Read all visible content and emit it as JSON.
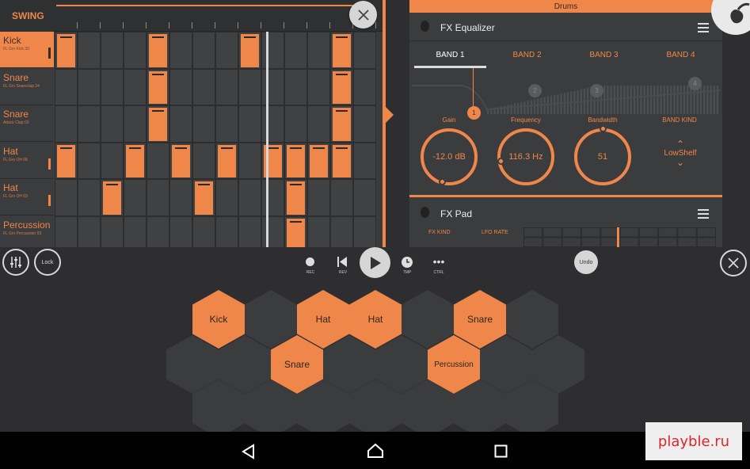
{
  "sequencer": {
    "swing_label": "SWING",
    "tracks": [
      {
        "name": "Kick",
        "sample": "FL Grv Kick 30",
        "selected": true
      },
      {
        "name": "Snare",
        "sample": "FL Grv Snareclap 24",
        "selected": false
      },
      {
        "name": "Snare",
        "sample": "Attack Clap 03",
        "selected": false
      },
      {
        "name": "Hat",
        "sample": "FL Grv OH 08",
        "selected": false
      },
      {
        "name": "Hat",
        "sample": "FL Grv OH 03",
        "selected": false
      },
      {
        "name": "Percussion",
        "sample": "FL Grv Percussion 03",
        "selected": false
      }
    ],
    "steps_on": [
      [
        0,
        4,
        8,
        12
      ],
      [
        4,
        12
      ],
      [
        4,
        12
      ],
      [
        0,
        3,
        5,
        7,
        9,
        10,
        11,
        12
      ],
      [
        2,
        6,
        10
      ],
      [
        10
      ]
    ],
    "playhead_step": 9
  },
  "fx_panel": {
    "channel_title": "Drums",
    "eq_title": "FX Equalizer",
    "bands": [
      "BAND 1",
      "BAND 2",
      "BAND 3",
      "BAND 4"
    ],
    "active_band": 0,
    "band_nodes": [
      "1",
      "2",
      "3",
      "4"
    ],
    "params": {
      "gain_label": "Gain",
      "gain_value": "-12.0 dB",
      "frequency_label": "Frequency",
      "frequency_value": "116.3 Hz",
      "bandwidth_label": "Bandwidth",
      "bandwidth_value": "51",
      "band_kind_label": "BAND KIND",
      "band_kind_value": "LowShelf"
    },
    "pad_title": "FX Pad",
    "fx_kind_label": "FX KIND",
    "lfo_rate_label": "LFO RATE"
  },
  "transport": {
    "lock_label": "Lock",
    "rec_label": "REC",
    "rev_label": "REV",
    "tmp_label": "TMP",
    "ctrl_label": "CTRL",
    "undo_label": "Undo"
  },
  "pads": {
    "labels": [
      "Kick",
      "Hat",
      "Hat",
      "Snare",
      "Snare",
      "Percussion"
    ]
  },
  "watermark": "playble.ru",
  "colors": {
    "accent": "#f0874a",
    "panel": "#3b3c3e",
    "background": "#2e2e30"
  }
}
